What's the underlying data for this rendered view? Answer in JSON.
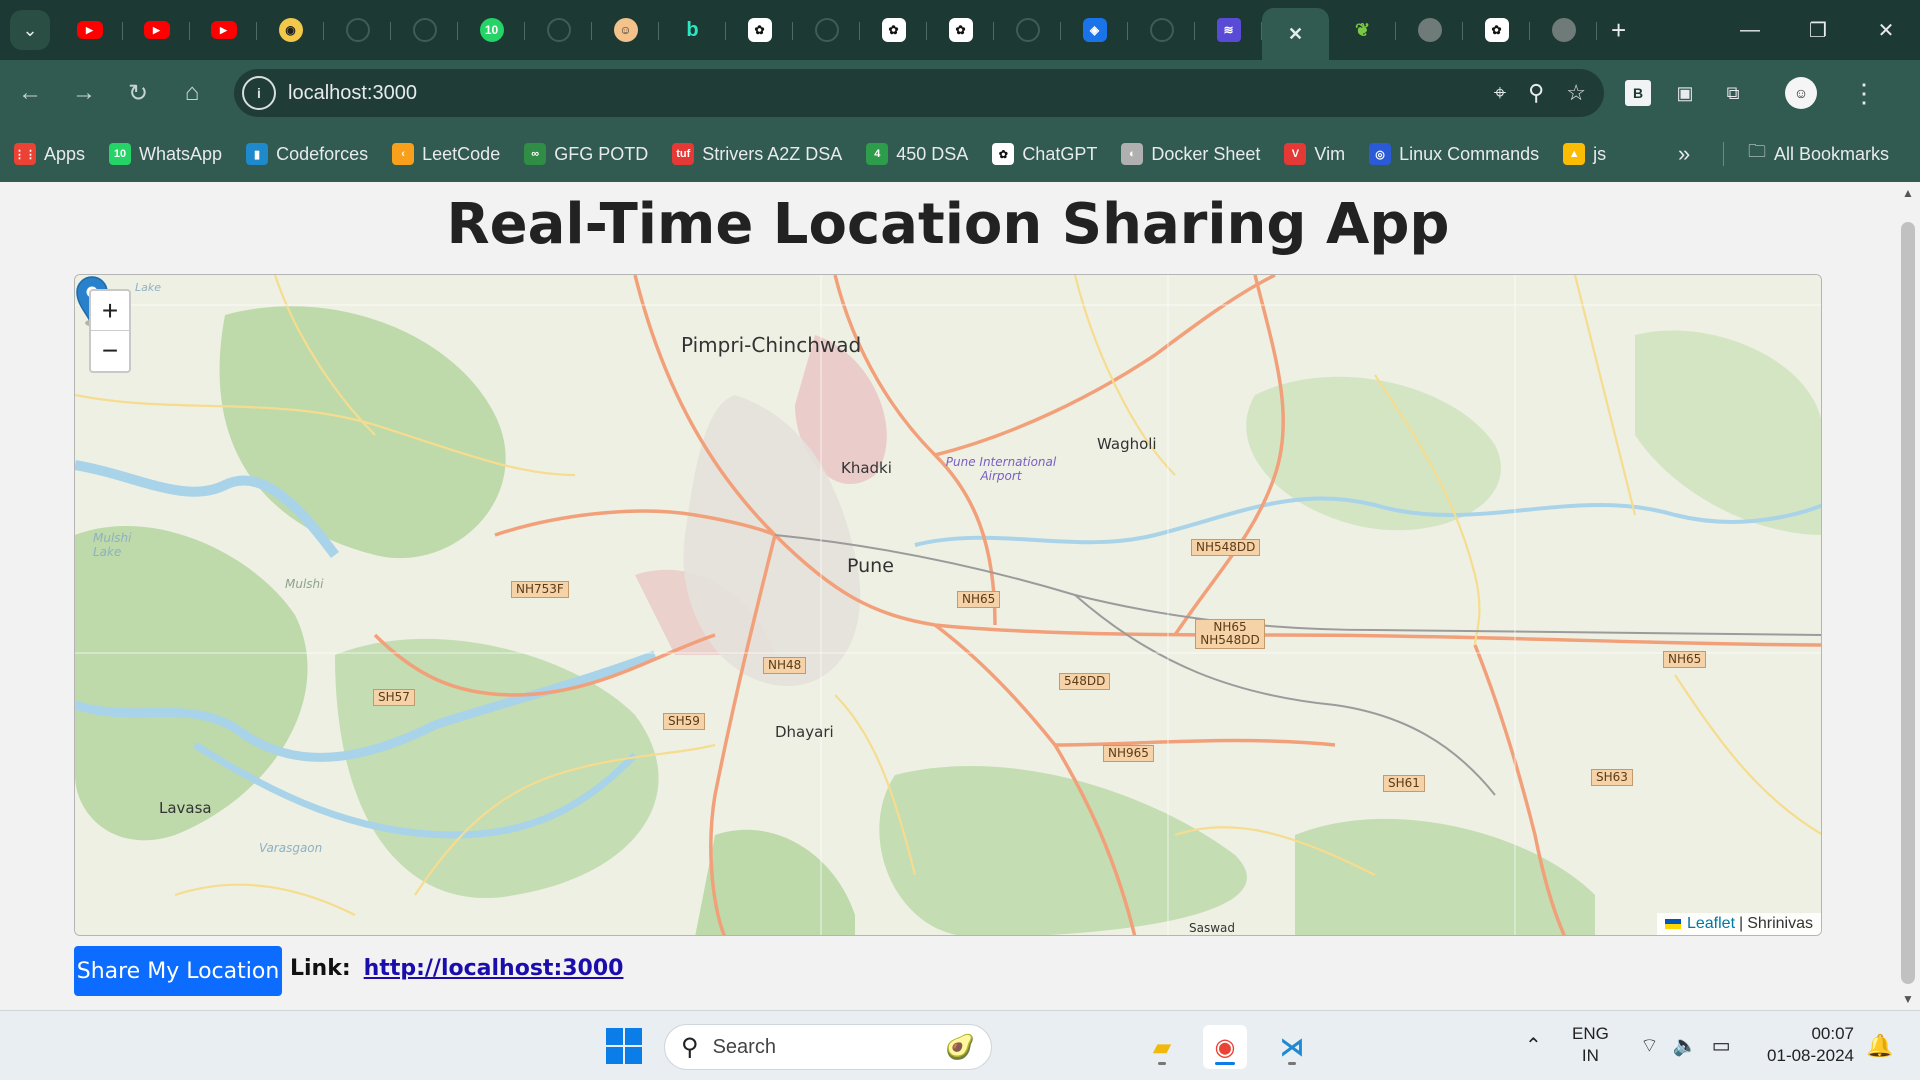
{
  "browser": {
    "tabs": [
      {
        "icon": "youtube-icon",
        "glyph": "▶"
      },
      {
        "icon": "youtube-icon",
        "glyph": "▶"
      },
      {
        "icon": "youtube-icon",
        "glyph": "▶"
      },
      {
        "icon": "copilot-icon",
        "glyph": "◉"
      },
      {
        "icon": "github-icon",
        "glyph": ""
      },
      {
        "icon": "github-icon",
        "glyph": ""
      },
      {
        "icon": "whatsapp-icon",
        "glyph": "10"
      },
      {
        "icon": "github-icon",
        "glyph": ""
      },
      {
        "icon": "avatar-face-icon",
        "glyph": "☺"
      },
      {
        "icon": "bing-icon",
        "glyph": "b"
      },
      {
        "icon": "openai-icon",
        "glyph": "✿"
      },
      {
        "icon": "github-icon",
        "glyph": ""
      },
      {
        "icon": "openai-icon",
        "glyph": "✿"
      },
      {
        "icon": "openai-icon",
        "glyph": "✿"
      },
      {
        "icon": "github-icon",
        "glyph": ""
      },
      {
        "icon": "maps-pin-icon",
        "glyph": "◈"
      },
      {
        "icon": "github-icon",
        "glyph": ""
      },
      {
        "icon": "stack-layers-icon",
        "glyph": "≋"
      },
      {
        "icon": "close-icon",
        "glyph": "✕",
        "active": true
      },
      {
        "icon": "leaf-icon",
        "glyph": "❦"
      },
      {
        "icon": "globe-icon",
        "glyph": ""
      },
      {
        "icon": "openai-icon",
        "glyph": "✿"
      },
      {
        "icon": "globe-icon",
        "glyph": ""
      }
    ],
    "url": "localhost:3000",
    "extension_b_label": "B"
  },
  "bookmarks": [
    {
      "label": "Apps",
      "icon": "apps-grid-icon",
      "color": "#ea4335",
      "glyph": "⋮⋮"
    },
    {
      "label": "WhatsApp",
      "icon": "whatsapp-icon",
      "color": "#25d366",
      "glyph": "10"
    },
    {
      "label": "Codeforces",
      "icon": "codeforces-icon",
      "color": "#1f8acb",
      "glyph": "▮"
    },
    {
      "label": "LeetCode",
      "icon": "leetcode-icon",
      "color": "#f89f1b",
      "glyph": "‹"
    },
    {
      "label": "GFG POTD",
      "icon": "gfg-icon",
      "color": "#2f8d46",
      "glyph": "∞"
    },
    {
      "label": "Strivers A2Z DSA",
      "icon": "tuf-icon",
      "color": "#e53935",
      "glyph": "tuf"
    },
    {
      "label": "450 DSA",
      "icon": "dsa450-icon",
      "color": "#2e9d4b",
      "glyph": "4"
    },
    {
      "label": "ChatGPT",
      "icon": "openai-icon",
      "color": "#ffffff",
      "glyph": "✿"
    },
    {
      "label": "Docker Sheet",
      "icon": "docker-icon",
      "color": "#b0b0b0",
      "glyph": "◐"
    },
    {
      "label": "Vim",
      "icon": "vim-icon",
      "color": "#e53935",
      "glyph": "V"
    },
    {
      "label": "Linux Commands",
      "icon": "linux-icon",
      "color": "#2b5ad6",
      "glyph": "◎"
    },
    {
      "label": "js",
      "icon": "google-drive-icon",
      "color": "#fbbc04",
      "glyph": "▲"
    }
  ],
  "bookmarks_all": "All Bookmarks",
  "page": {
    "title": "Real-Time Location Sharing App",
    "share_button": "Share My Location",
    "link_label": "Link:",
    "link_url": "http://localhost:3000"
  },
  "map": {
    "zoom_in": "+",
    "zoom_out": "−",
    "attribution_leaflet": "Leaflet",
    "attribution_sep": "|",
    "attribution_author": "Shrinivas",
    "places": [
      {
        "key": "pimpri",
        "text": "Pimpri-Chinchwad"
      },
      {
        "key": "wagholi",
        "text": "Wagholi"
      },
      {
        "key": "khadki",
        "text": "Khadki"
      },
      {
        "key": "airport",
        "text": "Pune International Airport"
      },
      {
        "key": "pune",
        "text": "Pune"
      },
      {
        "key": "dhayari",
        "text": "Dhayari"
      },
      {
        "key": "lavasa",
        "text": "Lavasa"
      },
      {
        "key": "mulshi",
        "text": "Mulshi"
      },
      {
        "key": "mulshi_lake",
        "text": "Mulshi Lake"
      },
      {
        "key": "varasgaon",
        "text": "Varasgaon"
      },
      {
        "key": "saswad",
        "text": "Saswad"
      },
      {
        "key": "lake",
        "text": "Lake"
      }
    ],
    "roads": [
      {
        "key": "nh548dd_top",
        "text": "NH548DD"
      },
      {
        "key": "nh753f",
        "text": "NH753F"
      },
      {
        "key": "nh65_center",
        "text": "NH65"
      },
      {
        "key": "nh65_nh548dd",
        "text": "NH65 NH548DD"
      },
      {
        "key": "nh65_right",
        "text": "NH65"
      },
      {
        "key": "nh48",
        "text": "NH48"
      },
      {
        "key": "sh57",
        "text": "SH57"
      },
      {
        "key": "dd548",
        "text": "548DD"
      },
      {
        "key": "sh59",
        "text": "SH59"
      },
      {
        "key": "nh965",
        "text": "NH965"
      },
      {
        "key": "sh61",
        "text": "SH61"
      },
      {
        "key": "sh63",
        "text": "SH63"
      }
    ],
    "marker": "location-marker-icon"
  },
  "taskbar": {
    "search_placeholder": "Search",
    "lang_1": "ENG",
    "lang_2": "IN",
    "time": "00:07",
    "date": "01-08-2024"
  },
  "colors": {
    "tab_strip": "#1c3a33",
    "toolbar": "#315b51",
    "share_button": "#0b6cff",
    "link": "#1a0dab",
    "marker": "#2a81cb"
  }
}
